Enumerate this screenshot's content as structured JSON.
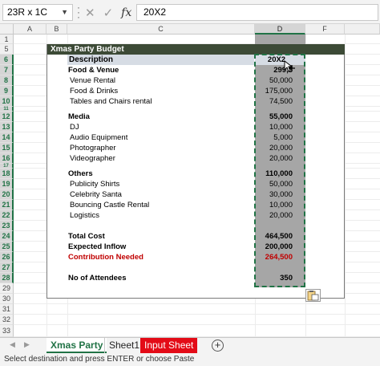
{
  "formula_bar": {
    "name_box": "23R x 1C",
    "cancel_icon": "x-icon",
    "enter_icon": "check-icon",
    "fx_label": "fx",
    "formula": "20X2"
  },
  "columns": [
    "A",
    "B",
    "C",
    "D",
    "F"
  ],
  "rows": [
    "1",
    "5",
    "6",
    "7",
    "8",
    "9",
    "10",
    "11",
    "12",
    "13",
    "14",
    "15",
    "16",
    "17",
    "18",
    "19",
    "20",
    "21",
    "22",
    "23",
    "24",
    "25",
    "26",
    "27",
    "28",
    "29",
    "30",
    "31",
    "32",
    "33"
  ],
  "sheet": {
    "title": "Xmas Party Budget",
    "header": {
      "label": "Description",
      "value": "20X2"
    },
    "lines": [
      {
        "label": "Food & Venue",
        "value": "299,5",
        "bold": true
      },
      {
        "label": "Venue Rental",
        "value": "50,000"
      },
      {
        "label": "Food & Drinks",
        "value": "175,000"
      },
      {
        "label": "Tables and Chairs rental",
        "value": "74,500"
      },
      {
        "label": "Media",
        "value": "55,000",
        "bold": true
      },
      {
        "label": "DJ",
        "value": "10,000"
      },
      {
        "label": "Audio Equipment",
        "value": "5,000"
      },
      {
        "label": "Photographer",
        "value": "20,000"
      },
      {
        "label": "Videographer",
        "value": "20,000"
      },
      {
        "label": "Others",
        "value": "110,000",
        "bold": true
      },
      {
        "label": "Publicity Shirts",
        "value": "50,000"
      },
      {
        "label": "Celebrity Santa",
        "value": "30,000"
      },
      {
        "label": "Bouncing Castle Rental",
        "value": "10,000"
      },
      {
        "label": "Logistics",
        "value": "20,000"
      },
      {
        "label": "Total Cost",
        "value": "464,500",
        "bold": true
      },
      {
        "label": "Expected Inflow",
        "value": "200,000",
        "bold": true
      },
      {
        "label": "Contribution Needed",
        "value": "264,500",
        "bold": true,
        "red": true
      },
      {
        "label": "No of Attendees",
        "value": "350",
        "bold": true
      }
    ]
  },
  "tabs": [
    "Xmas Party",
    "Sheet1",
    "Input Sheet"
  ],
  "status_text": "Select destination and press ENTER or choose Paste",
  "colors": {
    "accent": "#217346",
    "title_bar": "#3c4a36",
    "tab_red": "#e30b17",
    "negative": "#c00000"
  }
}
